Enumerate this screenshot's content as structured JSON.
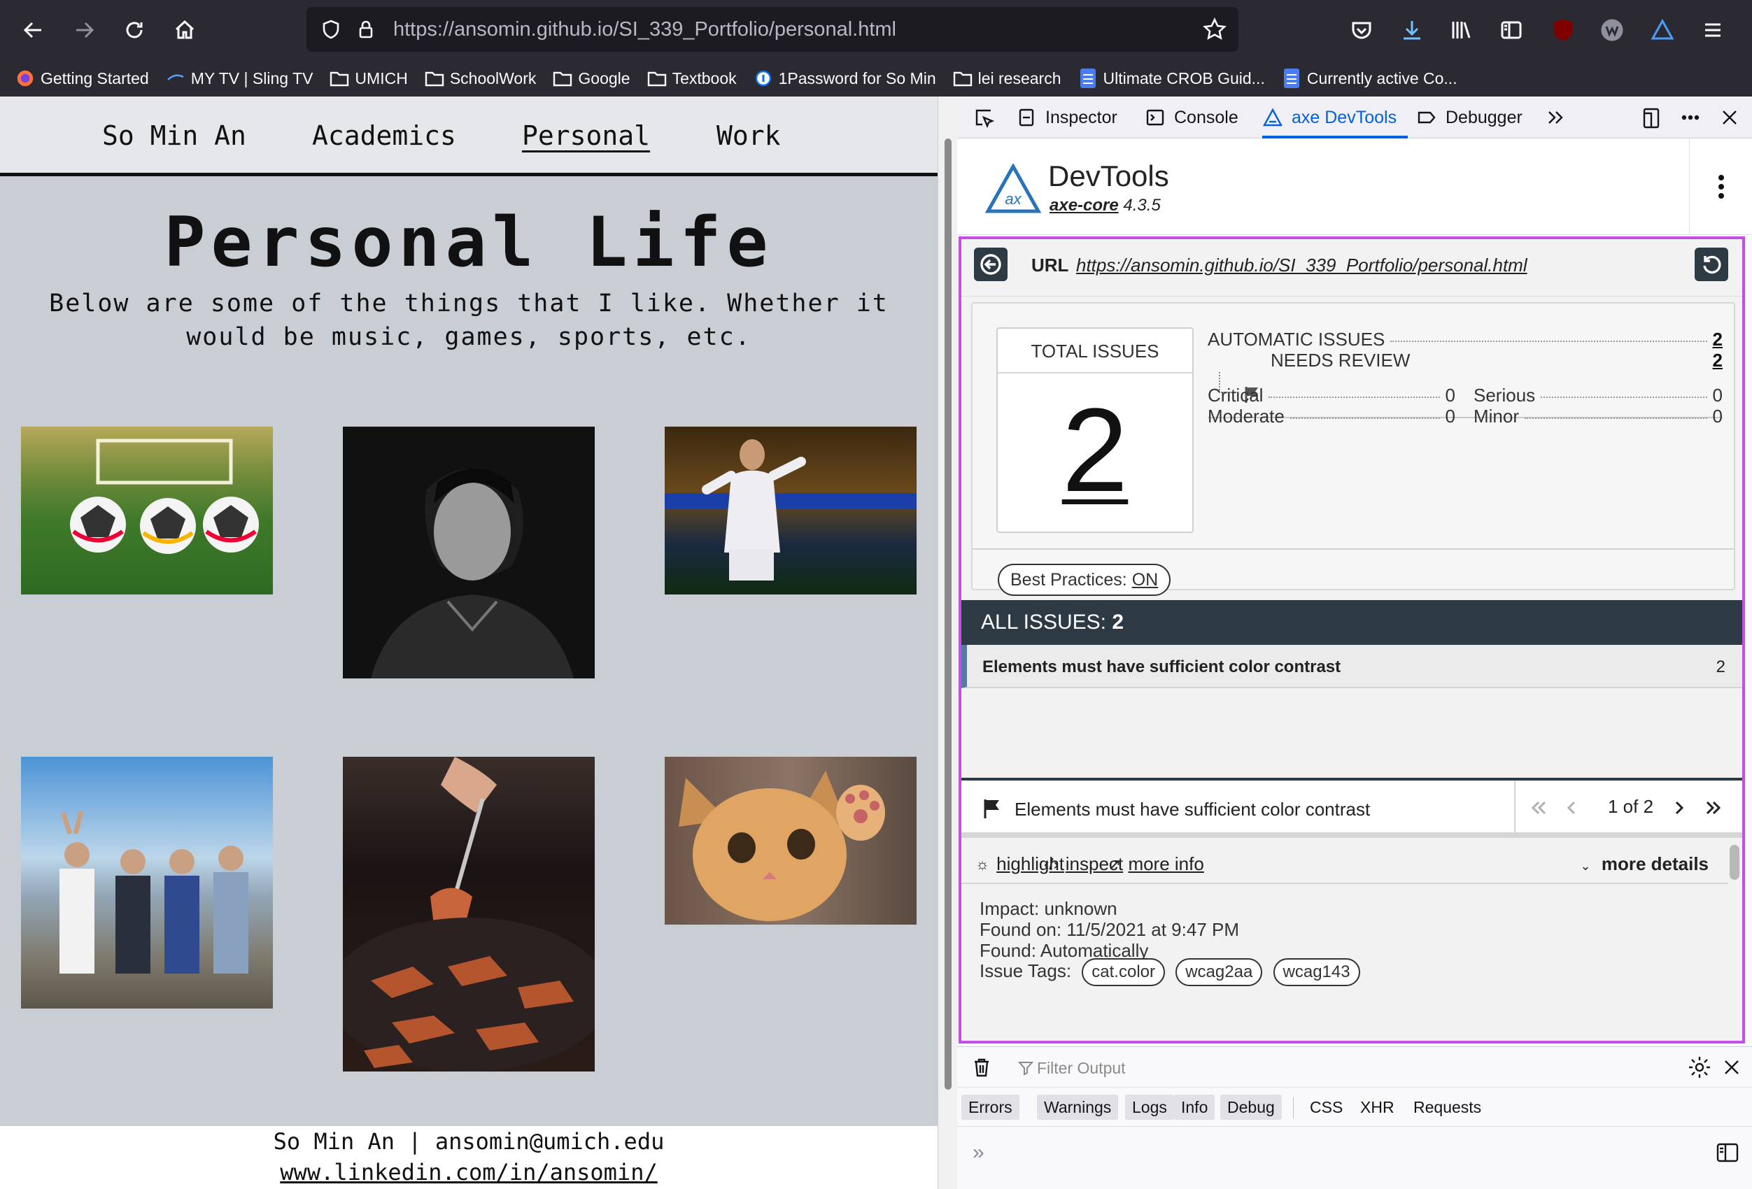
{
  "browser": {
    "url": "https://ansomin.github.io/SI_339_Portfolio/personal.html",
    "bookmarks": [
      {
        "label": "Getting Started",
        "icon": "firefox-icon"
      },
      {
        "label": "MY TV | Sling TV",
        "icon": "sling-icon"
      },
      {
        "label": "UMICH",
        "icon": "folder-icon"
      },
      {
        "label": "SchoolWork",
        "icon": "folder-icon"
      },
      {
        "label": "Google",
        "icon": "folder-icon"
      },
      {
        "label": "Textbook",
        "icon": "folder-icon"
      },
      {
        "label": "1Password for So Min",
        "icon": "onepassword-icon"
      },
      {
        "label": "lei research",
        "icon": "folder-icon"
      },
      {
        "label": "Ultimate CROB Guid...",
        "icon": "doc-icon"
      },
      {
        "label": "Currently active Co...",
        "icon": "doc-icon"
      }
    ]
  },
  "site": {
    "nav": [
      "So Min An",
      "Academics",
      "Personal",
      "Work"
    ],
    "active_nav": "Personal",
    "title": "Personal Life",
    "description": "Below are some of the things that I like. Whether it would be music, games, sports, etc.",
    "photos": [
      "soccer balls",
      "portrait",
      "soccer player",
      "friends",
      "barbecue",
      "kitten"
    ],
    "footer_line1": "So Min An | ansomin@umich.edu",
    "footer_line2": "www.linkedin.com/in/ansomin/"
  },
  "devtools": {
    "tabs": [
      "Inspector",
      "Console",
      "axe DevTools",
      "Debugger"
    ],
    "selected_tab": "axe DevTools",
    "axe": {
      "name": "DevTools",
      "core_label": "axe-core",
      "core_version": "4.3.5",
      "url_label": "URL",
      "url": "https://ansomin.github.io/SI_339_Portfolio/personal.html",
      "total_label": "TOTAL ISSUES",
      "total": "2",
      "automatic_label": "AUTOMATIC ISSUES",
      "automatic": "2",
      "review_label": "NEEDS REVIEW",
      "review": "2",
      "critical_label": "Critical",
      "critical": "0",
      "serious_label": "Serious",
      "serious": "0",
      "moderate_label": "Moderate",
      "moderate": "0",
      "minor_label": "Minor",
      "minor": "0",
      "best_practices_label": "Best Practices:",
      "best_practices_value": "ON",
      "all_issues_label": "ALL ISSUES:",
      "all_issues_count": "2",
      "issue_name": "Elements must have sufficient color contrast",
      "issue_count": "2",
      "detail_title": "Elements must have sufficient color contrast",
      "pager": "1 of 2",
      "highlight": "highlight",
      "inspect": "inspect",
      "more_info": "more info",
      "more_details": "more details",
      "impact": "Impact: unknown",
      "found_on": "Found on: 11/5/2021 at 9:47 PM",
      "found": "Found: Automatically",
      "tags_label": "Issue Tags:",
      "tags": [
        "cat.color",
        "wcag2aa",
        "wcag143"
      ]
    },
    "console": {
      "filter_placeholder": "Filter Output",
      "levels": [
        "Errors",
        "Warnings",
        "Logs",
        "Info",
        "Debug"
      ],
      "types": [
        "CSS",
        "XHR",
        "Requests"
      ]
    }
  },
  "colors": {
    "accent_purple": "#c44fe6",
    "axe_dark": "#2d3943",
    "selected_blue": "#0061e0"
  }
}
